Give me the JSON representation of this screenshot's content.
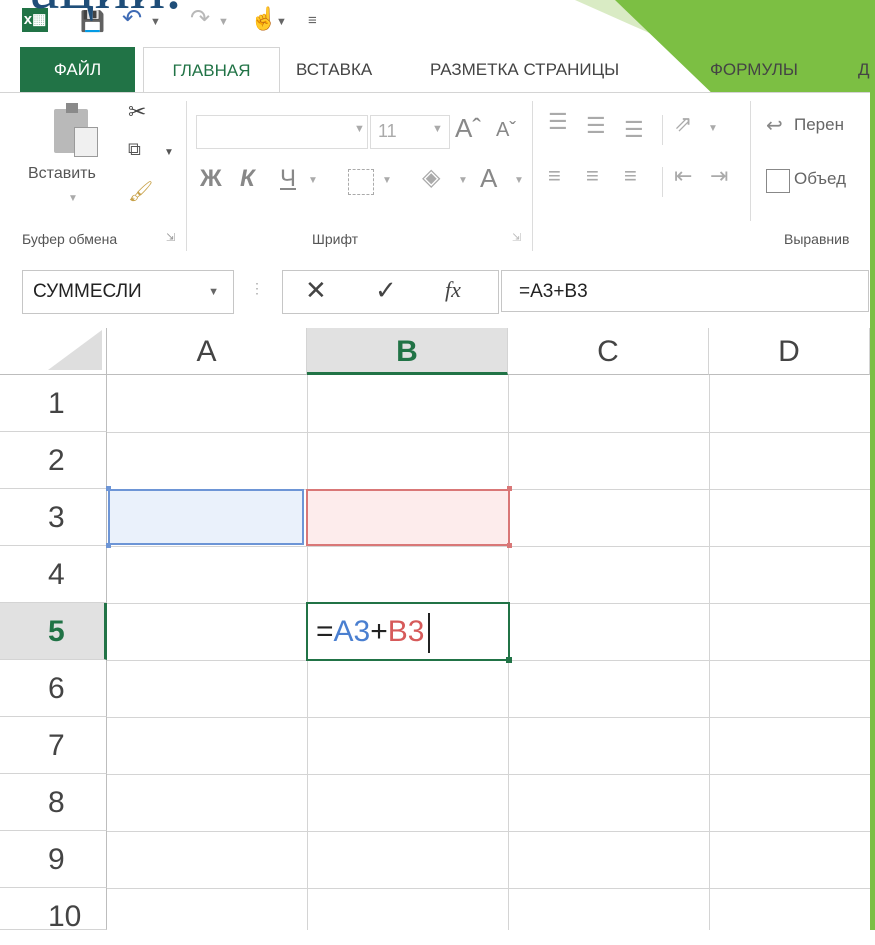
{
  "slide": {
    "title_fragment": "ации."
  },
  "qat": {
    "icons": [
      "excel-logo-icon",
      "save-icon",
      "undo-icon",
      "redo-icon",
      "touch-mode-icon",
      "customize-qat-icon"
    ]
  },
  "tabs": [
    {
      "label": "ФАЙЛ"
    },
    {
      "label": "ГЛАВНАЯ"
    },
    {
      "label": "ВСТАВКА"
    },
    {
      "label": "РАЗМЕТКА СТРАНИЦЫ"
    },
    {
      "label": "ФОРМУЛЫ"
    },
    {
      "label": "Д"
    }
  ],
  "ribbon": {
    "paste_label": "Вставить",
    "clipboard_group": "Буфер обмена",
    "font_size": "11",
    "bold": "Ж",
    "italic": "К",
    "underline": "Ч",
    "font_color": "A",
    "font_group": "Шрифт",
    "wrap_text": "Перен",
    "merge": "Объед",
    "align_group": "Выравнив"
  },
  "formula_bar": {
    "name_box": "СУММЕСЛИ",
    "fx": "fx",
    "formula": "=A3+B3"
  },
  "grid": {
    "columns": [
      "A",
      "B",
      "C",
      "D"
    ],
    "rows": [
      "1",
      "2",
      "3",
      "4",
      "5",
      "6",
      "7",
      "8",
      "9",
      "10"
    ],
    "selected_column": "B",
    "selected_row": "5",
    "edit_cell": {
      "eq": "=",
      "ref1": "A3",
      "plus": "+",
      "ref2": "B3"
    }
  },
  "colors": {
    "excel_green": "#217346",
    "ref1_blue": "#4a7fd0",
    "ref2_red": "#d65a5a",
    "slide_green": "#7cbf43"
  }
}
